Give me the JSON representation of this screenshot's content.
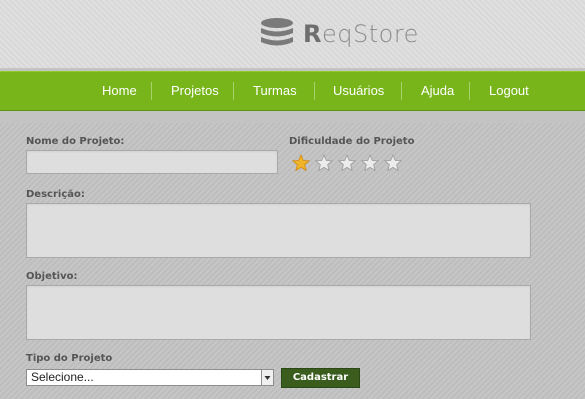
{
  "logo": {
    "brand_initial": "R",
    "brand_rest": "eqStore",
    "icon": "database-icon"
  },
  "nav": {
    "items": [
      {
        "label": "Home"
      },
      {
        "label": "Projetos"
      },
      {
        "label": "Turmas"
      },
      {
        "label": "Usuários"
      },
      {
        "label": "Ajuda"
      },
      {
        "label": "Logout"
      }
    ],
    "color": "#78b51b"
  },
  "form": {
    "nome_label": "Nome do Projeto:",
    "nome_value": "",
    "dificuldade_label": "Dificuldade do Projeto",
    "dificuldade_rating": 1,
    "dificuldade_max": 5,
    "descricao_label": "Descrição:",
    "descricao_value": "",
    "objetivo_label": "Objetivo:",
    "objetivo_value": "",
    "tipo_label": "Tipo do Projeto",
    "tipo_selected": "Selecione...",
    "submit_label": "Cadastrar"
  },
  "colors": {
    "accent": "#78b51b",
    "button": "#3a5d1e",
    "star_active": "#f0b429",
    "star_inactive": "#ffffff"
  }
}
